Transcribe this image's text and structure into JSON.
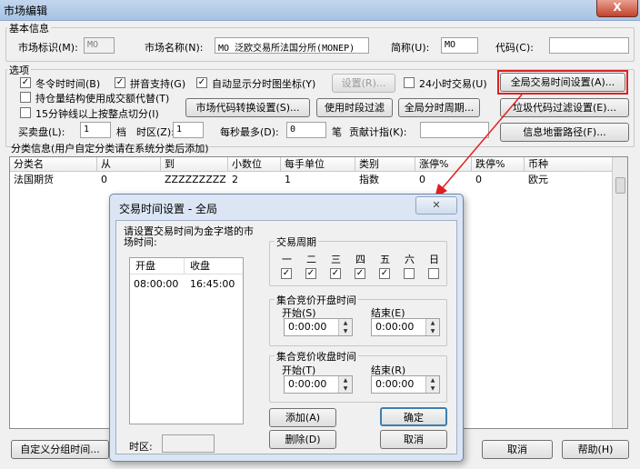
{
  "window": {
    "title": "市场编辑",
    "close_glyph": "X"
  },
  "basic": {
    "group_title": "基本信息",
    "market_id_label": "市场标识(M):",
    "market_id_value": "MO",
    "market_name_label": "市场名称(N):",
    "market_name_value": "MO 泛欧交易所法国分所(MONEP)",
    "short_label": "简称(U):",
    "short_value": "MO",
    "code_label": "代码(C):",
    "code_value": ""
  },
  "options": {
    "group_title": "选项",
    "dst": {
      "label": "冬令时时间(B)",
      "checked": "✓"
    },
    "pinyin": {
      "label": "拼音支持(G)",
      "checked": "✓"
    },
    "auto_coord": {
      "label": "自动显示分时图坐标(Y)",
      "checked": "✓"
    },
    "settings_button": "设置(R)...",
    "trade24": {
      "label": "24小时交易(U)",
      "checked": ""
    },
    "global_time_button": "全局交易时间设置(A)...",
    "position_vol": {
      "label": "持仓量结构使用成交额代替(T)",
      "checked": ""
    },
    "min15": {
      "label": "15分钟线以上按整点切分(I)",
      "checked": ""
    },
    "code_convert_button": "市场代码转换设置(S)...",
    "session_filter_button": "使用时段过滤",
    "global_period_button": "全局分时周期...",
    "junk_filter_button": "垃圾代码过滤设置(E)...",
    "bidask_label": "买卖盘(L):",
    "bidask_value": "1",
    "bidask_unit": "档",
    "tz_label": "时区(Z):",
    "tz_value": "1",
    "per_sec_label": "每秒最多(D):",
    "per_sec_value": "0",
    "per_sec_unit": "笔",
    "contrib_label": "贡献计指(K):",
    "contrib_value": "",
    "radar_button": "信息地雷路径(F)..."
  },
  "category": {
    "title": "分类信息(用户自定分类请在系统分类后添加)",
    "columns": [
      "分类名",
      "从",
      "到",
      "小数位",
      "每手单位",
      "类别",
      "涨停%",
      "跌停%",
      "币种"
    ],
    "rows": [
      [
        "法国期货",
        "0",
        "ZZZZZZZZZ",
        "2",
        "1",
        "指数",
        "0",
        "0",
        "欧元"
      ]
    ]
  },
  "footer": {
    "custom_group_button": "自定义分组时间...",
    "cancel_button": "取消",
    "help_button": "帮助(H)"
  },
  "dialog": {
    "title": "交易时间设置 - 全局",
    "close_glyph": "✕",
    "instruction": "请设置交易时间为金字塔的市场时间:",
    "list_columns": [
      "开盘",
      "收盘"
    ],
    "list_rows": [
      [
        "08:00:00",
        "16:45:00"
      ]
    ],
    "period_title": "交易周期",
    "weekdays": [
      "一",
      "二",
      "三",
      "四",
      "五",
      "六",
      "日"
    ],
    "weekday_checks": [
      "✓",
      "✓",
      "✓",
      "✓",
      "✓",
      "",
      ""
    ],
    "open_auction_title": "集合竞价开盘时间",
    "open_start_label": "开始(S)",
    "open_start_value": "0:00:00",
    "open_end_label": "结束(E)",
    "open_end_value": "0:00:00",
    "close_auction_title": "集合竞价收盘时间",
    "close_start_label": "开始(T)",
    "close_start_value": "0:00:00",
    "close_end_label": "结束(R)",
    "close_end_value": "0:00:00",
    "add_button": "添加(A)",
    "confirm_button": "确定",
    "delete_button": "删除(D)",
    "cancel_button": "取消",
    "tz_label": "时区:",
    "tz_value": ""
  },
  "annotation_color": "#e02020"
}
